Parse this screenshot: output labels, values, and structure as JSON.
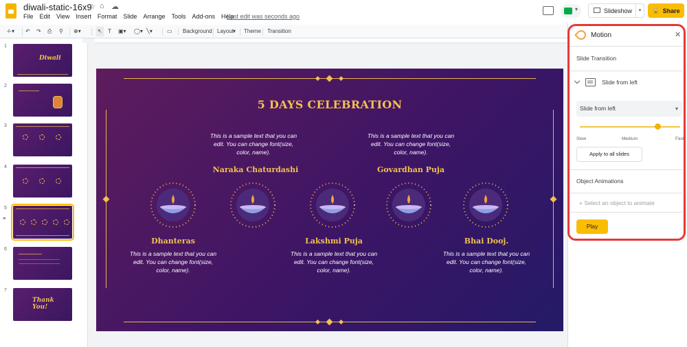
{
  "header": {
    "title": "diwali-static-16x9",
    "menu": [
      "File",
      "Edit",
      "View",
      "Insert",
      "Format",
      "Slide",
      "Arrange",
      "Tools",
      "Add-ons",
      "Help"
    ],
    "last_edit": "Last edit was seconds ago",
    "slideshow_label": "Slideshow",
    "share_label": "Share"
  },
  "toolbar": {
    "background": "Background",
    "layout": "Layout",
    "theme": "Theme",
    "transition": "Transition"
  },
  "filmstrip": {
    "numbers": [
      "1",
      "2",
      "3",
      "4",
      "5",
      "6",
      "7"
    ],
    "thumb1_text": "Diwali",
    "thumb7_text": "Thank You!"
  },
  "slide": {
    "title": "5 DAYS CELEBRATION",
    "sample_text": "This is a sample text that you can edit. You can change font(size, color, name).",
    "days": {
      "dhanteras": "Dhanteras",
      "naraka": "Naraka Chaturdashi",
      "lakshmi": "Lakshmi Puja",
      "govardhan": "Govardhan Puja",
      "bhai": "Bhai Dooj."
    }
  },
  "motion_panel": {
    "title": "Motion",
    "slide_transition": "Slide Transition",
    "transition_name": "Slide from left",
    "dropdown_value": "Slide from left",
    "speed_labels": [
      "Slow",
      "Medium",
      "Fast"
    ],
    "speed_fraction": 0.78,
    "apply_all": "Apply to all slides",
    "object_animations": "Object Animations",
    "add_animation": "+ Select an object to animate",
    "play": "Play"
  },
  "colors": {
    "accent": "#fbbc04",
    "slide_gold": "#f2c14e",
    "highlight_border": "#e53935"
  }
}
